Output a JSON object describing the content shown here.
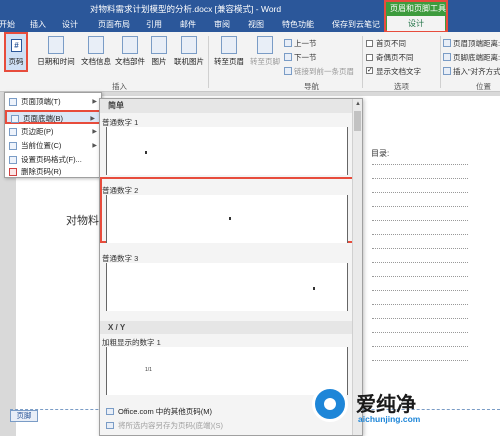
{
  "window": {
    "title": "对物料需求计划模型的分析.docx [兼容模式] - Word"
  },
  "tabs": [
    "开始",
    "插入",
    "设计",
    "页面布局",
    "引用",
    "邮件",
    "审阅",
    "视图",
    "特色功能",
    "保存到云笔记"
  ],
  "context_tab": {
    "group_label": "页眉和页脚工具",
    "tab": "设计"
  },
  "ribbon": {
    "page_number": "页码",
    "date_time": "日期和时间",
    "doc_info": "文档信息",
    "doc_parts": "文档部件",
    "picture": "图片",
    "online_picture": "联机图片",
    "goto_header": "转至页眉",
    "goto_footer": "转至页脚",
    "prev": "上一节",
    "next": "下一节",
    "link_prev": "链接到前一条页眉",
    "group_insert": "插入",
    "group_nav": "导航",
    "group_options": "选项",
    "group_position": "位置",
    "opt_first": "首页不同",
    "opt_oddeven": "奇偶页不同",
    "opt_show_text": "显示文档文字",
    "pos_header_top": "页眉顶端距离:",
    "pos_footer_bottom": "页脚底端距离:",
    "pos_align_tab": "插入\"对齐方式\"",
    "first_label": "首",
    "bracket_label": "["
  },
  "menu": {
    "items": [
      {
        "label": "页面顶端(T)",
        "arrow": "▶"
      },
      {
        "label": "页面底端(B)",
        "arrow": "▶"
      },
      {
        "label": "页边距(P)",
        "arrow": "▶"
      },
      {
        "label": "当前位置(C)",
        "arrow": "▶"
      },
      {
        "label": "设置页码格式(F)...",
        "arrow": ""
      },
      {
        "label": "删除页码(R)",
        "arrow": ""
      }
    ]
  },
  "gallery": {
    "section_simple": "简单",
    "item1": "普通数字 1",
    "item2": "普通数字 2",
    "item3": "普通数字 3",
    "section_xy": "X / Y",
    "item4": "加粗显示的数字 1",
    "preview4_text": "1/1",
    "more_office": "Office.com 中的其他页码(M)",
    "save_selection": "将所选内容另存为页码(底端)(S)"
  },
  "document": {
    "body_text": "对物料",
    "toc_title": "目录:",
    "footer_label": "页脚"
  },
  "watermark": {
    "brand": "爱纯净",
    "url": "aichunjing.com"
  },
  "colors": {
    "accent": "#2b579a",
    "context": "#3d9b3d",
    "highlight": "#e74c3c"
  }
}
